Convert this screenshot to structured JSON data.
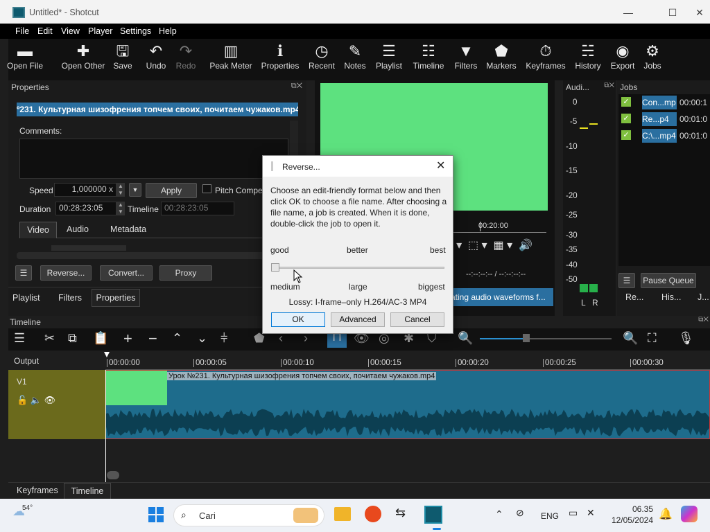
{
  "window": {
    "title": "Untitled* - Shotcut",
    "minimize": "—",
    "maximize": "☐",
    "close": "✕"
  },
  "menu": [
    "File",
    "Edit",
    "View",
    "Player",
    "Settings",
    "Help"
  ],
  "toolbar": [
    {
      "label": "Open File",
      "icon": "folder-open-icon",
      "glyph": "▬"
    },
    {
      "label": "Open Other",
      "icon": "open-other-icon",
      "glyph": "✚"
    },
    {
      "label": "Save",
      "icon": "save-icon",
      "glyph": "🖫"
    },
    {
      "label": "Undo",
      "icon": "undo-icon",
      "glyph": "↶"
    },
    {
      "label": "Redo",
      "icon": "redo-icon",
      "glyph": "↷",
      "disabled": true
    },
    {
      "label": "Peak Meter",
      "icon": "peak-meter-icon",
      "glyph": "▥"
    },
    {
      "label": "Properties",
      "icon": "properties-icon",
      "glyph": "ℹ"
    },
    {
      "label": "Recent",
      "icon": "recent-icon",
      "glyph": "◷"
    },
    {
      "label": "Notes",
      "icon": "notes-icon",
      "glyph": "✎"
    },
    {
      "label": "Playlist",
      "icon": "playlist-icon",
      "glyph": "☰"
    },
    {
      "label": "Timeline",
      "icon": "timeline-icon",
      "glyph": "☷"
    },
    {
      "label": "Filters",
      "icon": "filters-icon",
      "glyph": "▼"
    },
    {
      "label": "Markers",
      "icon": "markers-icon",
      "glyph": "⬟"
    },
    {
      "label": "Keyframes",
      "icon": "keyframes-icon",
      "glyph": "⏱"
    },
    {
      "label": "History",
      "icon": "history-icon",
      "glyph": "☵"
    },
    {
      "label": "Export",
      "icon": "export-icon",
      "glyph": "◉"
    },
    {
      "label": "Jobs",
      "icon": "jobs-icon",
      "glyph": "⚙"
    }
  ],
  "properties": {
    "header": "Properties",
    "clip_name": "º231. Культурная шизофрения топчем своих, почитаем чужаков.mp4",
    "comments_label": "Comments:",
    "speed_label": "Speed",
    "speed_value": "1,000000 x",
    "apply": "Apply",
    "pitch": "Pitch Compe",
    "duration_label": "Duration",
    "duration_value": "00:28:23:05",
    "timeline_label": "Timeline",
    "timeline_value": "00:28:23:05",
    "tabs": [
      "Video",
      "Audio",
      "Metadata"
    ],
    "buttons": [
      "Reverse...",
      "Convert...",
      "Proxy"
    ]
  },
  "bottom_tabs_left": [
    "Playlist",
    "Filters",
    "Properties"
  ],
  "player": {
    "time_mark": "00:20:00",
    "timecode": "--:--:--:-- / --:--:--:--",
    "status": "ating audio waveforms f..."
  },
  "audio": {
    "header": "Audi...",
    "scale": [
      "0",
      "-5",
      "-10",
      "-15",
      "-20",
      "-25",
      "-30",
      "-35",
      "-40",
      "-50"
    ],
    "lr": [
      "L",
      "R"
    ]
  },
  "jobs": {
    "header": "Jobs",
    "rows": [
      {
        "name": "Con...mp",
        "time": "00:00:1"
      },
      {
        "name": "Re...p4",
        "time": "00:01:0"
      },
      {
        "name": "C:\\...mp4",
        "time": "00:01:0"
      }
    ],
    "pause": "Pause Queue",
    "tabs": [
      "Re...",
      "His...",
      "J..."
    ]
  },
  "dialog": {
    "title": "Reverse...",
    "description": "Choose an edit-friendly format below and then click OK to choose a file name. After choosing a file name, a job is created. When it is done, double-click the job to open it.",
    "quality_top": [
      "good",
      "better",
      "best"
    ],
    "quality_bottom": [
      "medium",
      "large",
      "biggest"
    ],
    "format": "Lossy: I-frame–only H.264/AC-3 MP4",
    "ok": "OK",
    "advanced": "Advanced",
    "cancel": "Cancel",
    "slider_value": 0.0
  },
  "timeline": {
    "header": "Timeline",
    "output": "Output",
    "track": "V1",
    "ruler": [
      "00:00:00",
      "00:00:05",
      "00:00:10",
      "00:00:15",
      "00:00:20",
      "00:00:25",
      "00:00:30"
    ],
    "clip_title": "Урок №231. Культурная шизофрения топчем своих, почитаем чужаков.mp4",
    "bottom_tabs": [
      "Keyframes",
      "Timeline"
    ]
  },
  "taskbar": {
    "weather": "54°",
    "search": "Cari",
    "lang": "ENG",
    "time": "06.35",
    "date": "12/05/2024"
  },
  "colors": {
    "accent": "#5de17f",
    "selection": "#2a6fa0",
    "clip": "#1e6c8c",
    "track": "#6b6a1c"
  }
}
